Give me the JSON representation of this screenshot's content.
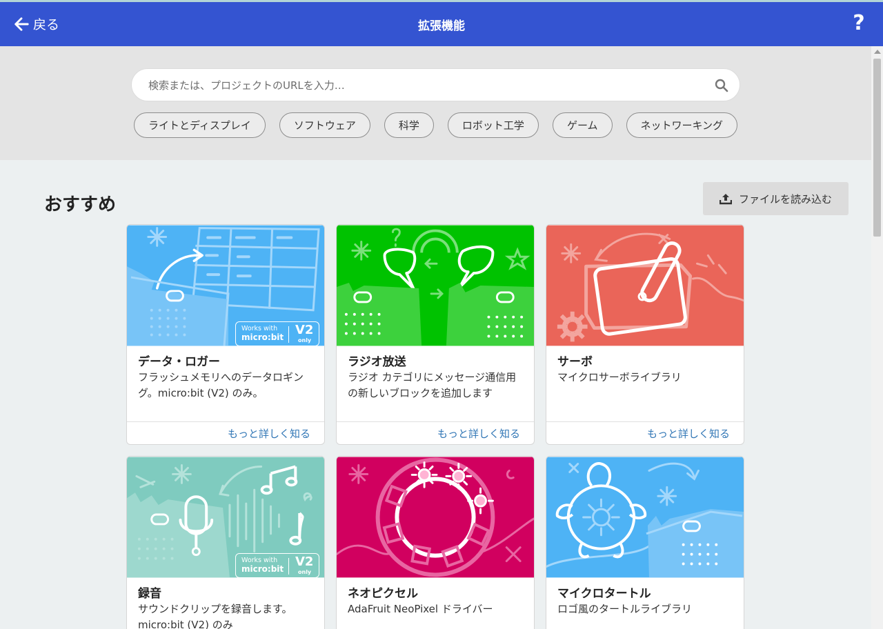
{
  "header": {
    "back_label": "戻る",
    "title": "拡張機能",
    "help_label": "?"
  },
  "search": {
    "placeholder": "検索または、プロジェクトのURLを入力…"
  },
  "categories": [
    "ライトとディスプレイ",
    "ソフトウェア",
    "科学",
    "ロボット工学",
    "ゲーム",
    "ネットワーキング"
  ],
  "section": {
    "title": "おすすめ",
    "import_label": "ファイルを読み込む"
  },
  "badge": {
    "works_with": "Works with",
    "product": "micro:bit",
    "version": "V2",
    "only": "only"
  },
  "cards": [
    {
      "title": "データ・ロガー",
      "description": "フラッシュメモリへのデータロギング。micro:bit (V2) のみ。",
      "learn_more": "もっと詳しく知る",
      "color": "#4eb3f5"
    },
    {
      "title": "ラジオ放送",
      "description": "ラジオ カテゴリにメッセージ通信用の新しいブロックを追加します",
      "learn_more": "もっと詳しく知る",
      "color": "#00c200"
    },
    {
      "title": "サーボ",
      "description": "マイクロサーボライブラリ",
      "learn_more": "もっと詳しく知る",
      "color": "#ea6559"
    },
    {
      "title": "録音",
      "description": "サウンドクリップを録音します。micro:bit (V2) のみ",
      "color": "#7fcbbf"
    },
    {
      "title": "ネオピクセル",
      "description": "AdaFruit NeoPixel ドライバー",
      "color": "#d1005f"
    },
    {
      "title": "マイクロタートル",
      "description": "ロゴ風のタートルライブラリ",
      "color": "#4eb3f5"
    }
  ]
}
